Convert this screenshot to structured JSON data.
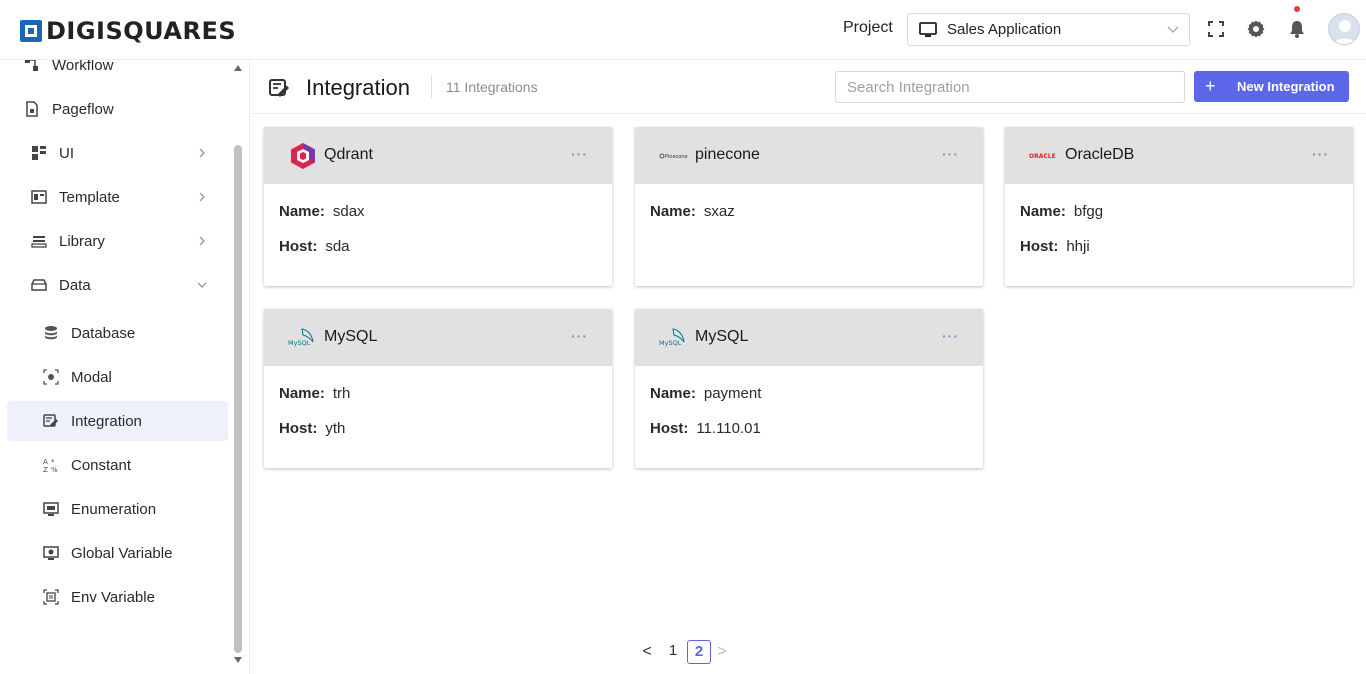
{
  "brand": {
    "name": "DIGISQUARES"
  },
  "header": {
    "project_label": "Project",
    "project_value": "Sales Application",
    "icons": [
      "fullscreen-icon",
      "gear-icon",
      "bell-icon",
      "avatar"
    ]
  },
  "sidebar": {
    "items": [
      {
        "label": "Workflow",
        "icon": "workflow-icon"
      },
      {
        "label": "Pageflow",
        "icon": "pageflow-icon"
      },
      {
        "label": "UI",
        "icon": "ui-icon",
        "expandable": true
      },
      {
        "label": "Template",
        "icon": "template-icon",
        "expandable": true
      },
      {
        "label": "Library",
        "icon": "library-icon",
        "expandable": true
      },
      {
        "label": "Data",
        "icon": "data-icon",
        "expanded": true
      },
      {
        "label": "Database",
        "icon": "database-icon"
      },
      {
        "label": "Modal",
        "icon": "modal-icon"
      },
      {
        "label": "Integration",
        "icon": "integration-icon",
        "active": true
      },
      {
        "label": "Constant",
        "icon": "constant-icon"
      },
      {
        "label": "Enumeration",
        "icon": "enumeration-icon"
      },
      {
        "label": "Global Variable",
        "icon": "global-variable-icon"
      },
      {
        "label": "Env Variable",
        "icon": "env-variable-icon"
      }
    ]
  },
  "page": {
    "title": "Integration",
    "count": "11 Integrations",
    "search_placeholder": "Search Integration",
    "new_button": "New Integration",
    "plus": "+"
  },
  "cards": [
    {
      "title": "Qdrant",
      "name_label": "Name:",
      "name": "sdax",
      "host_label": "Host:",
      "host": "sda"
    },
    {
      "title": "pinecone",
      "name_label": "Name:",
      "name": "sxaz",
      "logo_text": "Pinecone"
    },
    {
      "title": "OracleDB",
      "name_label": "Name:",
      "name": "bfgg",
      "host_label": "Host:",
      "host": "hhji",
      "logo_text": "ORACLE"
    },
    {
      "title": "MySQL",
      "name_label": "Name:",
      "name": "trh",
      "host_label": "Host:",
      "host": "yth",
      "logo_text": "MySQL"
    },
    {
      "title": "MySQL",
      "name_label": "Name:",
      "name": "payment",
      "host_label": "Host:",
      "host": "11.110.01",
      "logo_text": "MySQL"
    }
  ],
  "card_menu": "···",
  "pagination": {
    "prev": "<",
    "pages": [
      "1",
      "2"
    ],
    "current": "2",
    "next": ">"
  },
  "colors": {
    "accent": "#5b67e8",
    "brand": "#1769b8",
    "card_header": "#e1e1e1",
    "active_bg": "#eef1fc"
  }
}
